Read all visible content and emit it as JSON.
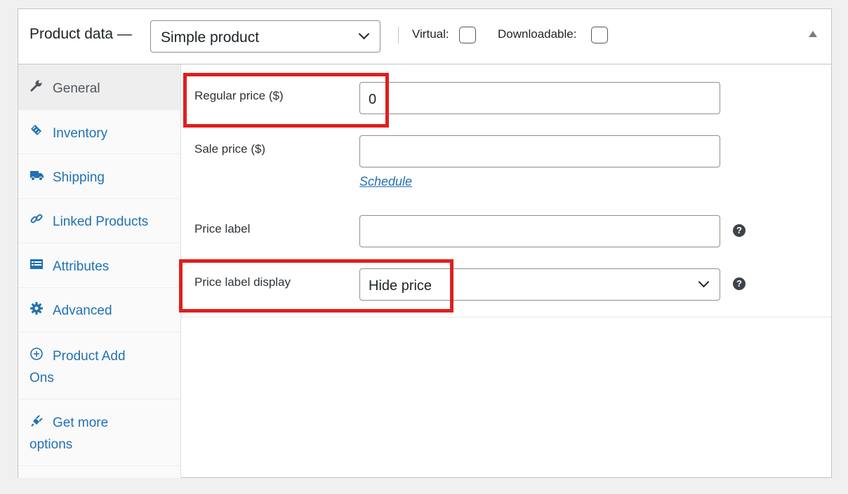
{
  "header": {
    "title": "Product data —",
    "product_type": "Simple product",
    "virtual_label": "Virtual:",
    "downloadable_label": "Downloadable:"
  },
  "tabs": [
    {
      "label": "General",
      "icon": "wrench-icon",
      "active": true
    },
    {
      "label": "Inventory",
      "icon": "tag-icon"
    },
    {
      "label": "Shipping",
      "icon": "truck-icon"
    },
    {
      "label": "Linked Products",
      "icon": "link-icon"
    },
    {
      "label": "Attributes",
      "icon": "list-icon"
    },
    {
      "label": "Advanced",
      "icon": "gear-icon"
    },
    {
      "label_line1": "Product Add",
      "label_line2": "Ons",
      "icon": "plus-circle-icon"
    },
    {
      "label_line1": "Get more",
      "label_line2": "options",
      "icon": "plug-icon"
    }
  ],
  "general": {
    "regular_price_label": "Regular price ($)",
    "regular_price_value": "0",
    "sale_price_label": "Sale price ($)",
    "sale_price_value": "",
    "schedule_link": "Schedule",
    "price_label_label": "Price label",
    "price_label_value": "",
    "price_label_display_label": "Price label display",
    "price_label_display_value": "Hide price",
    "help_glyph": "?"
  },
  "colors": {
    "accent": "#2271b1",
    "highlight": "#e01e1e"
  }
}
